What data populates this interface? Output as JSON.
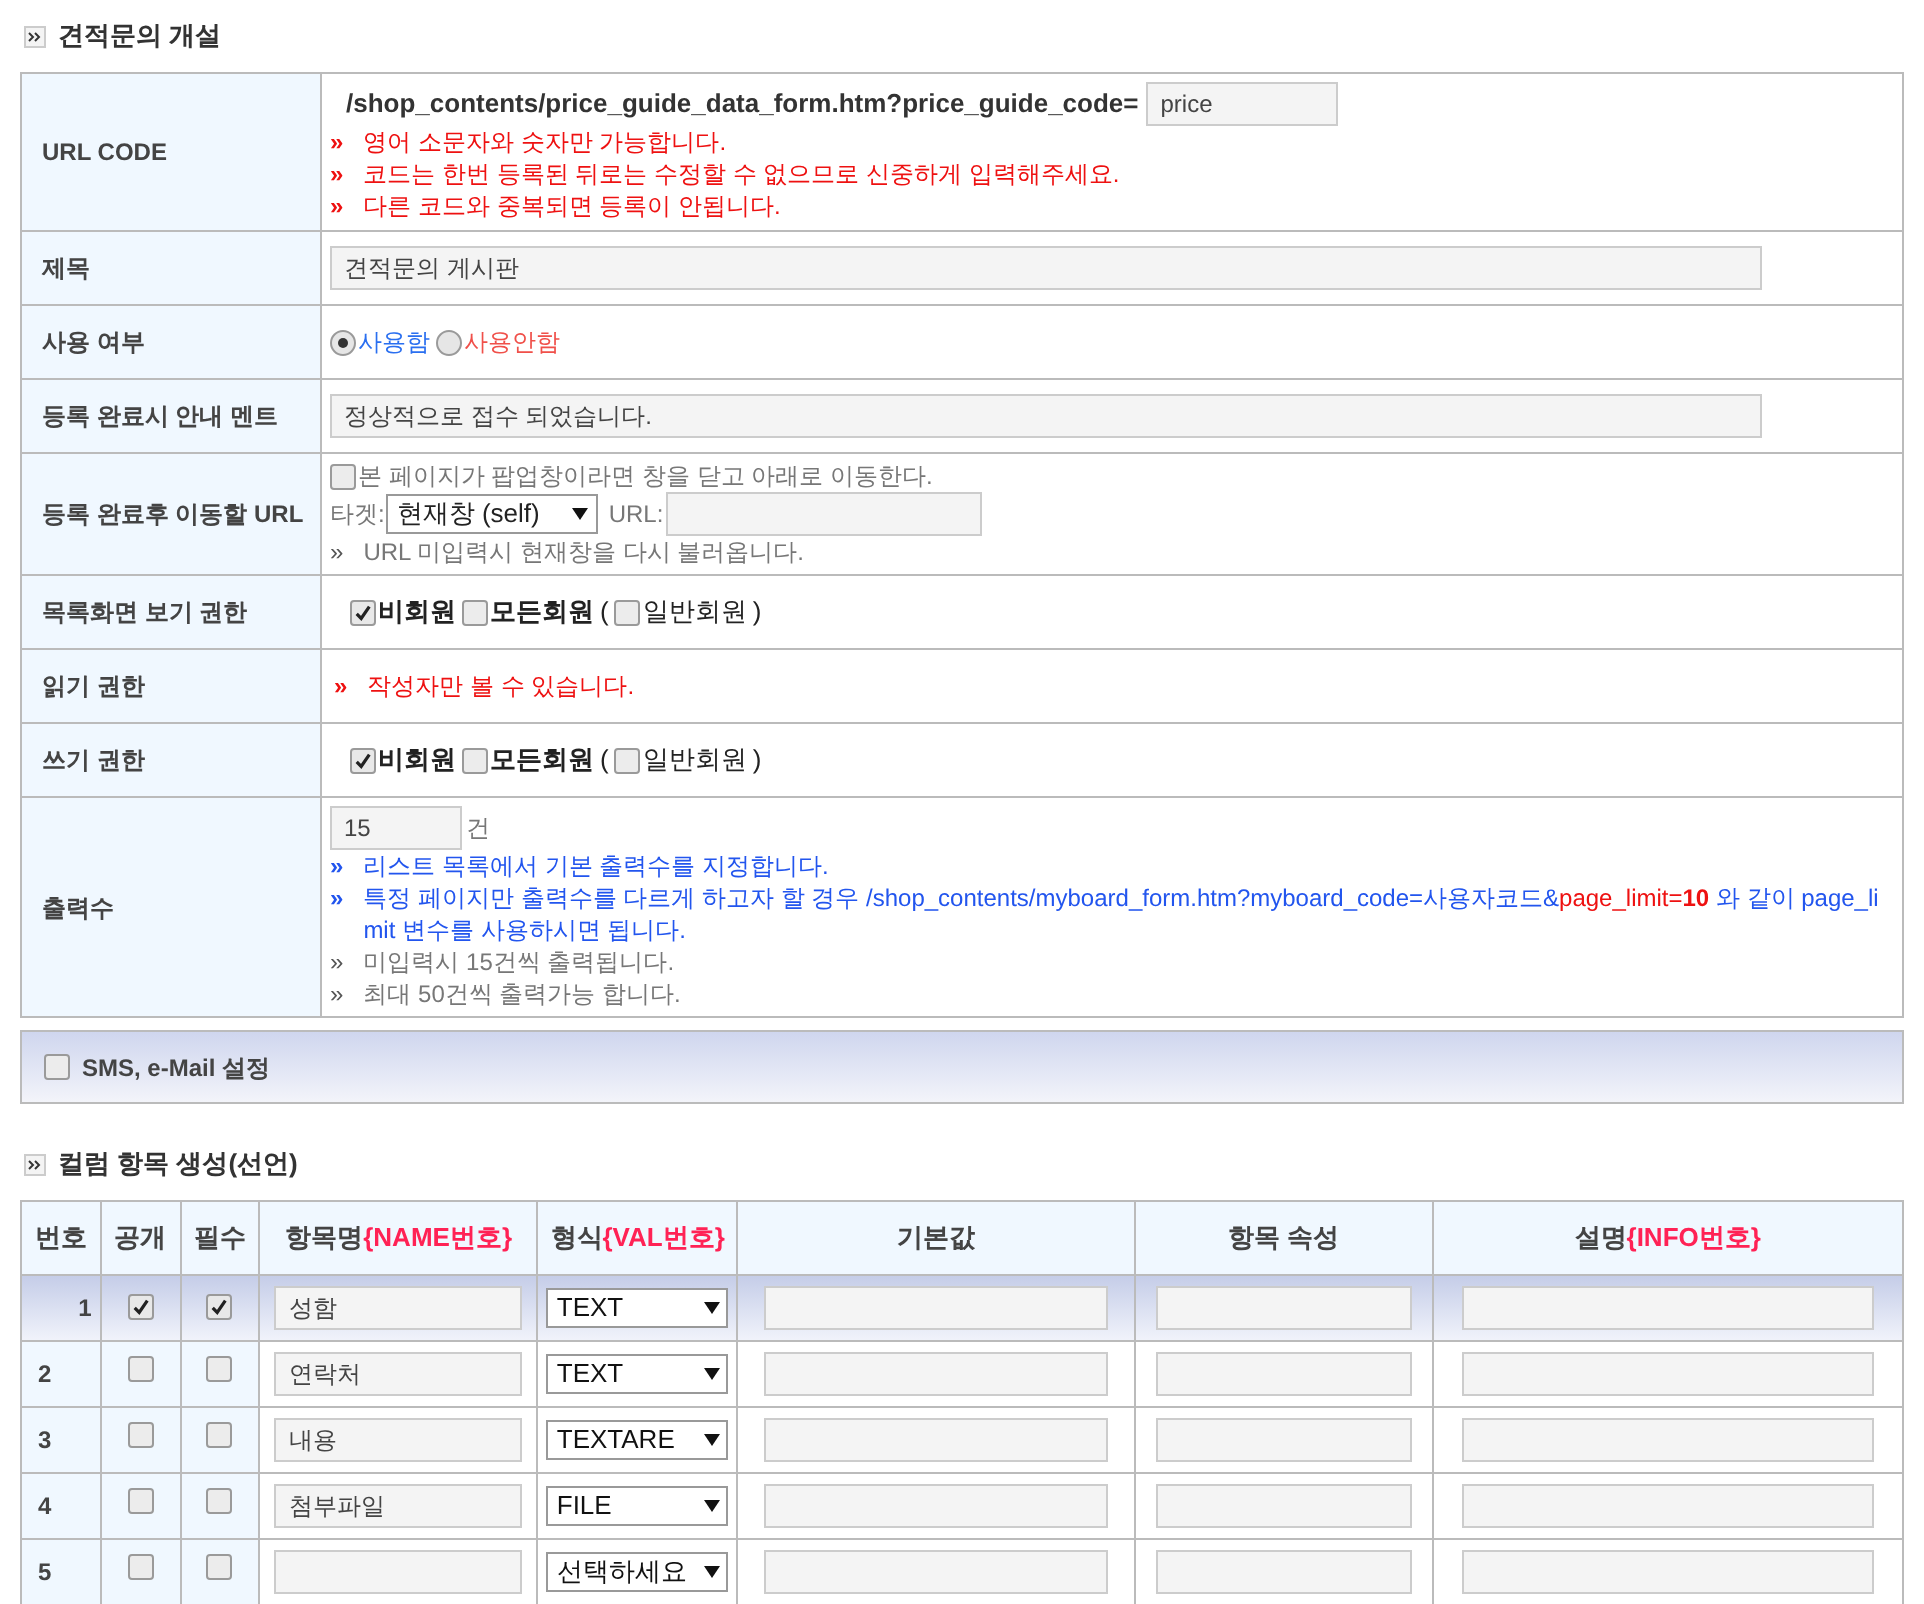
{
  "section_title": "견적문의 개설",
  "form_rows": [
    {
      "kind": "url_code",
      "label": "URL CODE",
      "prefix": "/shop_contents/price_guide_data_form.htm?price_guide_code=",
      "value": "price",
      "notes": [
        {
          "kind": "warning",
          "marker": "»",
          "text": "영어 소문자와 숫자만 가능합니다."
        },
        {
          "kind": "warning",
          "marker": "»",
          "text": "코드는 한번 등록된 뒤로는 수정할 수 없으므로 신중하게 입력해주세요."
        },
        {
          "kind": "warning",
          "marker": "»",
          "text": "다른 코드와 중복되면 등록이 안됩니다."
        }
      ]
    },
    {
      "kind": "text_input",
      "label": "제목",
      "value": "견적문의 게시판"
    },
    {
      "kind": "radio",
      "label": "사용 여부",
      "options": [
        {
          "label": "사용함",
          "selected": true,
          "color": "#2a6ff0"
        },
        {
          "label": "사용안함",
          "selected": false,
          "color": "#f0504a"
        }
      ]
    },
    {
      "kind": "text_input",
      "label": "등록 완료시 안내 멘트",
      "value": "정상적으로 접수 되었습니다."
    },
    {
      "kind": "redirect",
      "label": "등록 완료후 이동할 URL",
      "checkbox": {
        "label": "본 페이지가 팝업창이라면 창을 닫고 아래로 이동한다.",
        "checked": false
      },
      "target_label": "타겟:",
      "target_value": "현재창 (self)",
      "url_label": "URL:",
      "notes": [
        {
          "kind": "hint",
          "marker": "»",
          "text": "URL 미입력시 현재창을 다시 불러옵니다."
        }
      ]
    },
    {
      "kind": "permission",
      "label": "목록화면 보기 권한",
      "items": [
        {
          "kind": "checkbox",
          "label": "비회원",
          "checked": true
        },
        {
          "kind": "checkbox",
          "label": "모든회원",
          "checked": false
        },
        {
          "kind": "paren",
          "label": "("
        },
        {
          "kind": "checkbox",
          "label": "일반회원",
          "checked": false
        },
        {
          "kind": "paren",
          "label": ")"
        }
      ]
    },
    {
      "kind": "note",
      "label": "읽기 권한",
      "notes": [
        {
          "kind": "warning",
          "marker": "»",
          "text": "작성자만 볼 수 있습니다."
        }
      ]
    },
    {
      "kind": "permission",
      "label": "쓰기 권한",
      "items": [
        {
          "kind": "checkbox",
          "label": "비회원",
          "checked": true
        },
        {
          "kind": "checkbox",
          "label": "모든회원",
          "checked": false
        },
        {
          "kind": "paren",
          "label": "("
        },
        {
          "kind": "checkbox",
          "label": "일반회원",
          "checked": false
        },
        {
          "kind": "paren",
          "label": ")"
        }
      ]
    },
    {
      "kind": "count",
      "label": "출력수",
      "value": "15",
      "unit": "건",
      "notes": [
        {
          "kind": "info",
          "marker": "»",
          "text": "리스트 목록에서 기본 출력수를 지정합니다."
        },
        {
          "kind": "info",
          "marker": "»",
          "parts": [
            {
              "text": "특정 페이지만 출력수를 다르게 하고자 할 경우 /shop_contents/myboard_form.htm?myboard_code=사용자코드&",
              "highlight": false
            },
            {
              "text": "page_limit=**10**",
              "highlight": true
            },
            {
              "text": " 와 같이 page_limit 변수를 사용하시면 됩니다.",
              "highlight": false
            }
          ]
        },
        {
          "kind": "hint",
          "marker": "»",
          "text": "미입력시 15건씩 출력됩니다."
        },
        {
          "kind": "hint",
          "marker": "»",
          "text": "최대 50건씩 출력가능 합니다."
        }
      ]
    }
  ],
  "sms_panel": {
    "label": "SMS, e-Mail 설정",
    "checked": false
  },
  "column_section": {
    "title": "컬럼 항목 생성(선언)",
    "columns": [
      {
        "label": "번호"
      },
      {
        "label": "공개"
      },
      {
        "label": "필수"
      },
      {
        "label": "항목명",
        "code": "{NAME번호}"
      },
      {
        "label": "형식",
        "code": "{VAL번호}"
      },
      {
        "label": "기본값"
      },
      {
        "label": "항목 속성"
      },
      {
        "label": "설명",
        "code": "{INFO번호}"
      }
    ],
    "rows": [
      {
        "number": "1",
        "selected": true,
        "public": true,
        "required": true,
        "name": "성함",
        "type": "TEXT"
      },
      {
        "number": "2",
        "selected": false,
        "public": false,
        "required": false,
        "name": "연락처",
        "type": "TEXT"
      },
      {
        "number": "3",
        "selected": false,
        "public": false,
        "required": false,
        "name": "내용",
        "type": "TEXTARE"
      },
      {
        "number": "4",
        "selected": false,
        "public": false,
        "required": false,
        "name": "첨부파일",
        "type": "FILE"
      },
      {
        "number": "5",
        "selected": false,
        "public": false,
        "required": false,
        "type": "선택하세요"
      }
    ]
  }
}
